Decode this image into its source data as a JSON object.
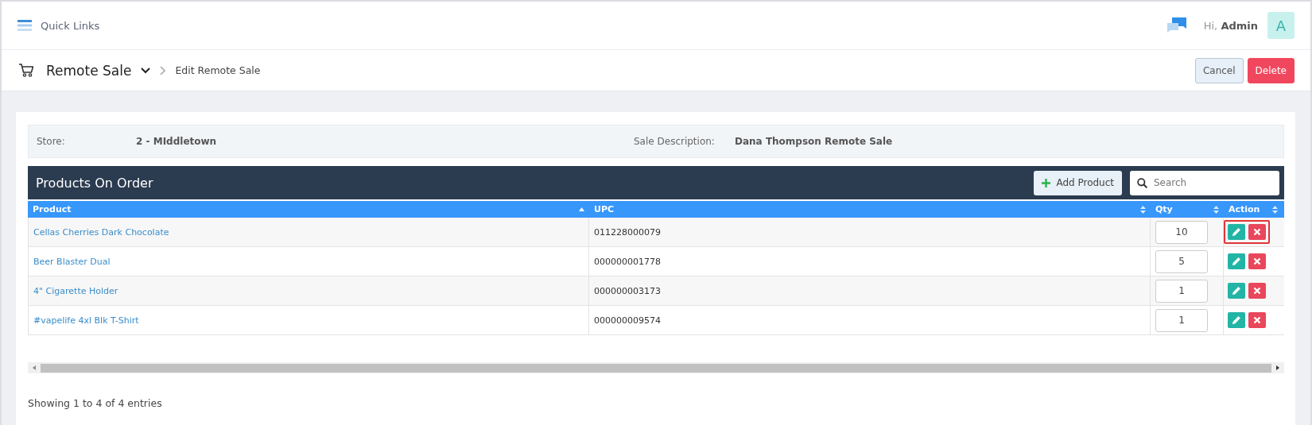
{
  "topbar": {
    "quick_links": "Quick Links",
    "greeting": "Hi,",
    "user": "Admin",
    "avatar": "A"
  },
  "page": {
    "title": "Remote Sale",
    "breadcrumb": "Edit Remote Sale",
    "buttons": [
      {
        "label": "Cancel",
        "kind": "cancel"
      },
      {
        "label": "Delete",
        "kind": "delete"
      }
    ]
  },
  "info": [
    {
      "label": "Store:",
      "value": "2 - MIddletown"
    },
    {
      "label": "Sale Description:",
      "value": "Dana Thompson Remote Sale"
    }
  ],
  "panel": {
    "title": "Products On Order",
    "add_button": "Add Product",
    "search": {
      "placeholder": "Search"
    }
  },
  "table": {
    "columns": [
      {
        "label": "Product",
        "sorted_ascending": true
      },
      {
        "label": "UPC",
        "sorted_ascending": false
      },
      {
        "label": "Qty",
        "sorted_ascending": false
      },
      {
        "label": "Action",
        "sorted_ascending": false
      }
    ],
    "rows": [
      {
        "product": "Cellas Cherries Dark Chocolate",
        "upc": "011228000079",
        "qty": "10",
        "highlighted": true
      },
      {
        "product": "Beer Blaster Dual",
        "upc": "000000001778",
        "qty": "5",
        "highlighted": false
      },
      {
        "product": "4\" Cigarette Holder",
        "upc": "000000003173",
        "qty": "1",
        "highlighted": false
      },
      {
        "product": "#vapelife 4xl Blk T-Shirt",
        "upc": "000000009574",
        "qty": "1",
        "highlighted": false
      }
    ]
  },
  "footer": "Showing 1 to 4 of 4 entries"
}
